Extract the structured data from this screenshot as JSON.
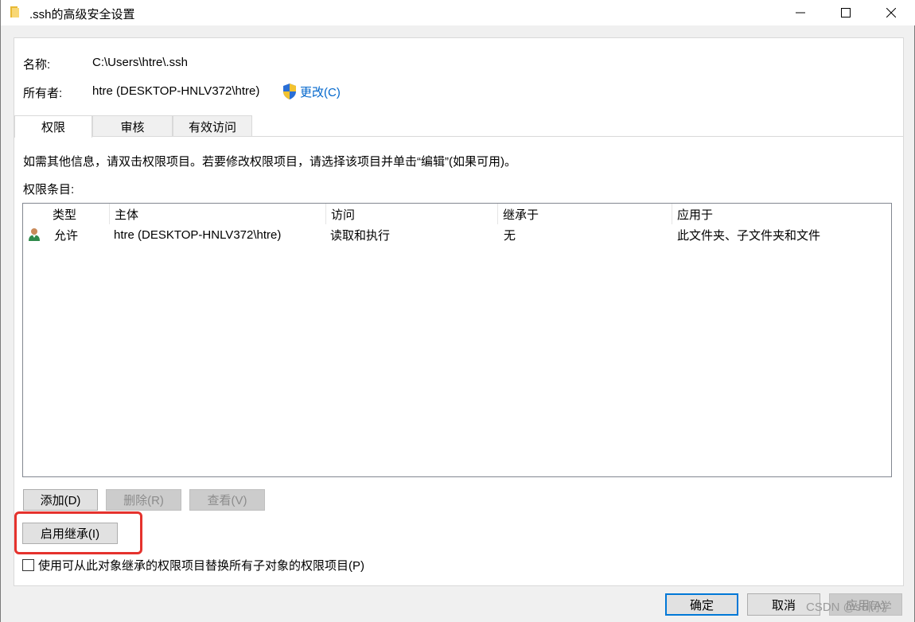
{
  "window": {
    "title": ".ssh的高级安全设置"
  },
  "info": {
    "name_label": "名称:",
    "name_value": "C:\\Users\\htre\\.ssh",
    "owner_label": "所有者:",
    "owner_value": "htre (DESKTOP-HNLV372\\htre)",
    "change_link": "更改(C)"
  },
  "tabs": [
    {
      "label": "权限",
      "active": true
    },
    {
      "label": "审核",
      "active": false
    },
    {
      "label": "有效访问",
      "active": false
    }
  ],
  "description": "如需其他信息，请双击权限项目。若要修改权限项目，请选择该项目并单击“编辑”(如果可用)。",
  "entries_label": "权限条目:",
  "table": {
    "columns": [
      "类型",
      "主体",
      "访问",
      "继承于",
      "应用于"
    ],
    "rows": [
      [
        "允许",
        "htre (DESKTOP-HNLV372\\htre)",
        "读取和执行",
        "无",
        "此文件夹、子文件夹和文件"
      ]
    ]
  },
  "buttons": {
    "add": "添加(D)",
    "delete": "删除(R)",
    "view": "查看(V)",
    "enable_inheritance": "启用继承(I)",
    "ok": "确定",
    "cancel": "取消",
    "apply": "应用(A)"
  },
  "checkbox": {
    "label": "使用可从此对象继承的权限项目替换所有子对象的权限项目(P)",
    "checked": false
  },
  "watermark": "CSDN @so同学",
  "colors": {
    "link": "#0066cc",
    "highlight": "#e5322d",
    "default_button_border": "#0078d7"
  }
}
